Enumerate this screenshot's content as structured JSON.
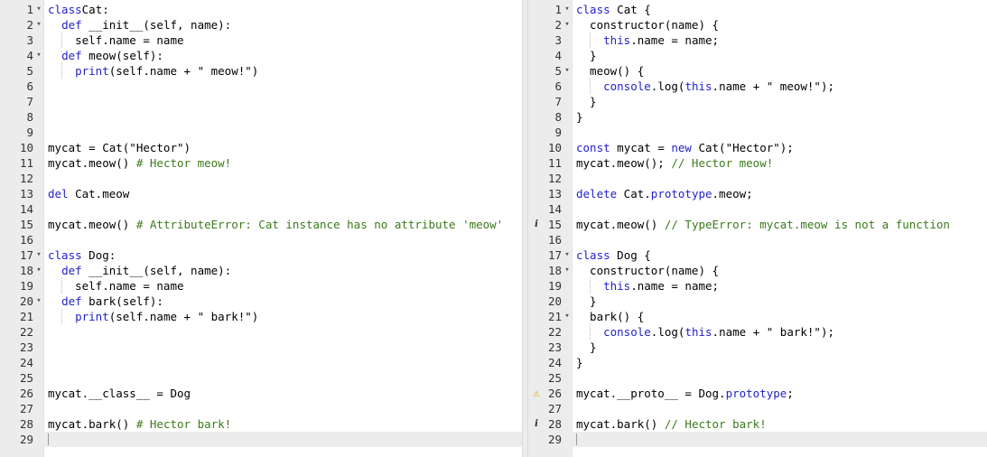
{
  "left_editor": {
    "language": "python",
    "active_line": 29,
    "lines": [
      {
        "n": "1",
        "fold": "▾",
        "segs": [
          [
            "kw",
            "class"
          ],
          [
            "",
            "Cat:"
          ]
        ]
      },
      {
        "n": "2",
        "fold": "▾",
        "guides": [],
        "segs": [
          [
            "",
            "  "
          ],
          [
            "kw",
            "def"
          ],
          [
            "",
            " __init__(self, name):"
          ]
        ]
      },
      {
        "n": "3",
        "guides": [
          18
        ],
        "segs": [
          [
            "",
            "    self.name = name"
          ]
        ]
      },
      {
        "n": "4",
        "fold": "▾",
        "segs": [
          [
            "",
            "  "
          ],
          [
            "kw",
            "def"
          ],
          [
            "",
            " meow(self):"
          ]
        ]
      },
      {
        "n": "5",
        "guides": [
          18
        ],
        "segs": [
          [
            "",
            "    "
          ],
          [
            "kw",
            "print"
          ],
          [
            "",
            "(self.name + \" meow!\")"
          ]
        ]
      },
      {
        "n": "6",
        "segs": []
      },
      {
        "n": "7",
        "segs": []
      },
      {
        "n": "8",
        "segs": []
      },
      {
        "n": "9",
        "segs": []
      },
      {
        "n": "10",
        "segs": [
          [
            "",
            "mycat = Cat(\"Hector\")"
          ]
        ]
      },
      {
        "n": "11",
        "segs": [
          [
            "",
            "mycat.meow() "
          ],
          [
            "cm",
            "# Hector meow!"
          ]
        ]
      },
      {
        "n": "12",
        "segs": []
      },
      {
        "n": "13",
        "segs": [
          [
            "kw",
            "del"
          ],
          [
            "",
            " Cat.meow"
          ]
        ]
      },
      {
        "n": "14",
        "segs": []
      },
      {
        "n": "15",
        "segs": [
          [
            "",
            "mycat.meow() "
          ],
          [
            "cm",
            "# AttributeError: Cat instance has no attribute 'meow'"
          ]
        ]
      },
      {
        "n": "16",
        "segs": []
      },
      {
        "n": "17",
        "fold": "▾",
        "segs": [
          [
            "kw",
            "class"
          ],
          [
            "",
            " Dog:"
          ]
        ]
      },
      {
        "n": "18",
        "fold": "▾",
        "segs": [
          [
            "",
            "  "
          ],
          [
            "kw",
            "def"
          ],
          [
            "",
            " __init__(self, name):"
          ]
        ]
      },
      {
        "n": "19",
        "guides": [
          18
        ],
        "segs": [
          [
            "",
            "    self.name = name"
          ]
        ]
      },
      {
        "n": "20",
        "fold": "▾",
        "segs": [
          [
            "",
            "  "
          ],
          [
            "kw",
            "def"
          ],
          [
            "",
            " bark(self):"
          ]
        ]
      },
      {
        "n": "21",
        "guides": [
          18
        ],
        "segs": [
          [
            "",
            "    "
          ],
          [
            "kw",
            "print"
          ],
          [
            "",
            "(self.name + \" bark!\")"
          ]
        ]
      },
      {
        "n": "22",
        "segs": []
      },
      {
        "n": "23",
        "segs": []
      },
      {
        "n": "24",
        "segs": []
      },
      {
        "n": "25",
        "segs": []
      },
      {
        "n": "26",
        "segs": [
          [
            "",
            "mycat.__class__ = Dog"
          ]
        ]
      },
      {
        "n": "27",
        "segs": []
      },
      {
        "n": "28",
        "segs": [
          [
            "",
            "mycat.bark() "
          ],
          [
            "cm",
            "# Hector bark!"
          ]
        ]
      },
      {
        "n": "29",
        "segs": []
      }
    ]
  },
  "right_editor": {
    "language": "javascript",
    "active_line": 29,
    "lines": [
      {
        "n": "1",
        "fold": "▾",
        "segs": [
          [
            "kw",
            "class"
          ],
          [
            "",
            " Cat {"
          ]
        ]
      },
      {
        "n": "2",
        "fold": "▾",
        "segs": [
          [
            "",
            "  constructor(name) {"
          ]
        ]
      },
      {
        "n": "3",
        "guides": [
          18
        ],
        "segs": [
          [
            "",
            "    "
          ],
          [
            "kw",
            "this"
          ],
          [
            "",
            ".name = name;"
          ]
        ]
      },
      {
        "n": "4",
        "segs": [
          [
            "",
            "  }"
          ]
        ]
      },
      {
        "n": "5",
        "fold": "▾",
        "segs": [
          [
            "",
            "  meow() {"
          ]
        ]
      },
      {
        "n": "6",
        "guides": [
          18
        ],
        "segs": [
          [
            "",
            "    "
          ],
          [
            "kw",
            "console"
          ],
          [
            "",
            ".log("
          ],
          [
            "kw",
            "this"
          ],
          [
            "",
            ".name + \" meow!\");"
          ]
        ]
      },
      {
        "n": "7",
        "segs": [
          [
            "",
            "  }"
          ]
        ]
      },
      {
        "n": "8",
        "segs": [
          [
            "",
            "}"
          ]
        ]
      },
      {
        "n": "9",
        "segs": []
      },
      {
        "n": "10",
        "segs": [
          [
            "kw",
            "const"
          ],
          [
            "",
            " mycat = "
          ],
          [
            "kw",
            "new"
          ],
          [
            "",
            " Cat(\"Hector\");"
          ]
        ]
      },
      {
        "n": "11",
        "segs": [
          [
            "",
            "mycat.meow(); "
          ],
          [
            "cm",
            "// Hector meow!"
          ]
        ]
      },
      {
        "n": "12",
        "segs": []
      },
      {
        "n": "13",
        "segs": [
          [
            "kw",
            "delete"
          ],
          [
            "",
            " Cat."
          ],
          [
            "kw",
            "prototype"
          ],
          [
            "",
            ".meow;"
          ]
        ]
      },
      {
        "n": "14",
        "segs": []
      },
      {
        "n": "15",
        "marker": "info",
        "segs": [
          [
            "",
            "mycat.meow() "
          ],
          [
            "cm",
            "// TypeError: mycat.meow is not a function"
          ]
        ]
      },
      {
        "n": "16",
        "segs": []
      },
      {
        "n": "17",
        "fold": "▾",
        "segs": [
          [
            "kw",
            "class"
          ],
          [
            "",
            " Dog {"
          ]
        ]
      },
      {
        "n": "18",
        "fold": "▾",
        "segs": [
          [
            "",
            "  constructor(name) {"
          ]
        ]
      },
      {
        "n": "19",
        "guides": [
          18
        ],
        "segs": [
          [
            "",
            "    "
          ],
          [
            "kw",
            "this"
          ],
          [
            "",
            ".name = name;"
          ]
        ]
      },
      {
        "n": "20",
        "segs": [
          [
            "",
            "  }"
          ]
        ]
      },
      {
        "n": "21",
        "fold": "▾",
        "segs": [
          [
            "",
            "  bark() {"
          ]
        ]
      },
      {
        "n": "22",
        "guides": [
          18
        ],
        "segs": [
          [
            "",
            "    "
          ],
          [
            "kw",
            "console"
          ],
          [
            "",
            ".log("
          ],
          [
            "kw",
            "this"
          ],
          [
            "",
            ".name + \" bark!\");"
          ]
        ]
      },
      {
        "n": "23",
        "segs": [
          [
            "",
            "  }"
          ]
        ]
      },
      {
        "n": "24",
        "segs": [
          [
            "",
            "}"
          ]
        ]
      },
      {
        "n": "25",
        "segs": []
      },
      {
        "n": "26",
        "marker": "warn",
        "segs": [
          [
            "",
            "mycat.__proto__ = Dog."
          ],
          [
            "kw",
            "prototype"
          ],
          [
            "",
            ";"
          ]
        ]
      },
      {
        "n": "27",
        "segs": []
      },
      {
        "n": "28",
        "marker": "info",
        "segs": [
          [
            "",
            "mycat.bark() "
          ],
          [
            "cm",
            "// Hector bark!"
          ]
        ]
      },
      {
        "n": "29",
        "segs": []
      }
    ]
  },
  "markers": {
    "info": "i",
    "warn": "⚠"
  },
  "colors": {
    "keyword": "#2222cc",
    "comment": "#3b7a1a",
    "gutter": "#ececec",
    "active_line": "#ececec",
    "warning": "#e6a400"
  }
}
